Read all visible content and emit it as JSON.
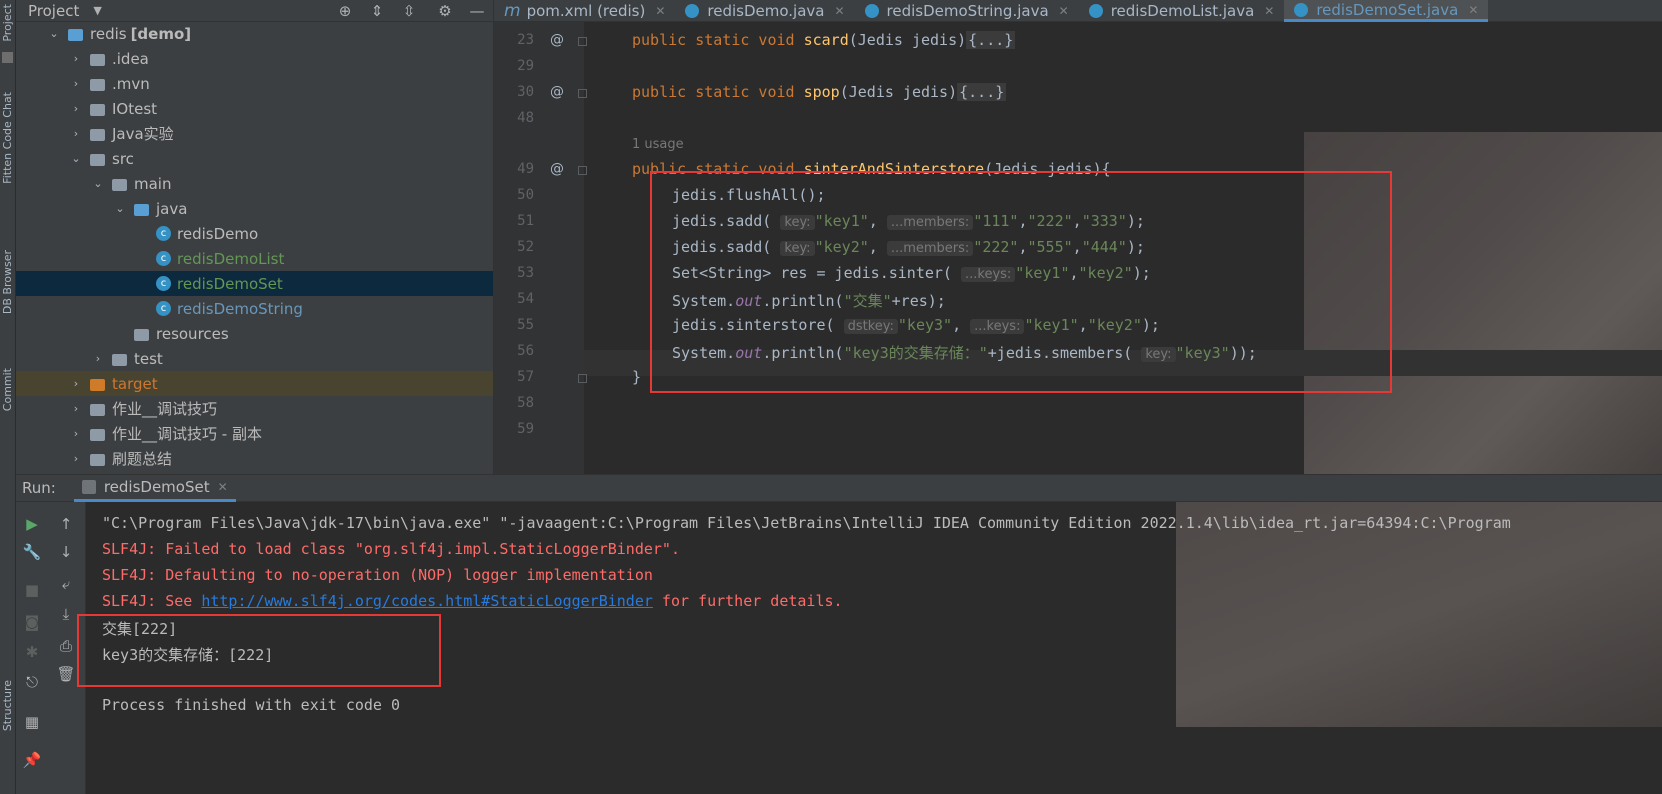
{
  "left_strip": {
    "labels": [
      "Project",
      "Fitten Code Chat",
      "DB Browser",
      "Commit",
      "Structure"
    ]
  },
  "project": {
    "title": "Project",
    "tree": [
      {
        "label": "redis",
        "suffix": "[demo]",
        "type": "folder-blue",
        "expanded": true
      },
      {
        "label": ".idea",
        "type": "folder",
        "expanded": false
      },
      {
        "label": ".mvn",
        "type": "folder",
        "expanded": false
      },
      {
        "label": "IOtest",
        "type": "folder",
        "expanded": false
      },
      {
        "label": "Java实验",
        "type": "folder",
        "expanded": false
      },
      {
        "label": "src",
        "type": "folder",
        "expanded": true
      },
      {
        "label": "main",
        "type": "folder",
        "expanded": true
      },
      {
        "label": "java",
        "type": "folder-blue",
        "expanded": true
      },
      {
        "label": "redisDemo",
        "type": "class",
        "color": "default"
      },
      {
        "label": "redisDemoList",
        "type": "class",
        "color": "green"
      },
      {
        "label": "redisDemoSet",
        "type": "class",
        "color": "green",
        "selected": true
      },
      {
        "label": "redisDemoString",
        "type": "class",
        "color": "blue"
      },
      {
        "label": "resources",
        "type": "folder-res"
      },
      {
        "label": "test",
        "type": "folder",
        "expanded": false
      },
      {
        "label": "target",
        "type": "folder-orange",
        "expanded": false,
        "excluded": true
      },
      {
        "label": "作业__调试技巧",
        "type": "folder",
        "expanded": false
      },
      {
        "label": "作业__调试技巧 - 副本",
        "type": "folder",
        "expanded": false
      },
      {
        "label": "刷题总结",
        "type": "folder",
        "expanded": false
      }
    ]
  },
  "tabs": [
    {
      "label": "pom.xml (redis)",
      "icon": "m",
      "active": false
    },
    {
      "label": "redisDemo.java",
      "icon": "class",
      "active": false
    },
    {
      "label": "redisDemoString.java",
      "icon": "class",
      "active": false
    },
    {
      "label": "redisDemoList.java",
      "icon": "class",
      "active": false
    },
    {
      "label": "redisDemoSet.java",
      "icon": "class",
      "active": true
    }
  ],
  "editor": {
    "line_numbers": [
      "23",
      "29",
      "30",
      "48",
      "49",
      "50",
      "51",
      "52",
      "53",
      "54",
      "55",
      "56",
      "57",
      "58",
      "59"
    ],
    "usage_hint": "1 usage",
    "hints": {
      "key": "key:",
      "members": "...members:",
      "keys": "...keys:",
      "dstkey": "dstkey:"
    },
    "lines": {
      "l23": {
        "kw": "public static void ",
        "fn": "scard",
        "rest": "(Jedis jedis)",
        "fold": "{...}"
      },
      "l30": {
        "kw": "public static void ",
        "fn": "spop",
        "rest": "(Jedis jedis)",
        "fold": "{...}"
      },
      "l49": {
        "kw": "public static void ",
        "fn": "sinterAndSinterstore",
        "rest": "(Jedis jedis){"
      },
      "l50": "jedis.flushAll();",
      "l51": {
        "pre": "jedis.sadd( ",
        "s1": "\"key1\"",
        "s2": "\"111\"",
        "s3": "\"222\"",
        "s4": "\"333\"",
        "end": ");"
      },
      "l52": {
        "pre": "jedis.sadd( ",
        "s1": "\"key2\"",
        "s2": "\"222\"",
        "s3": "\"555\"",
        "s4": "\"444\"",
        "end": ");"
      },
      "l53": {
        "pre": "Set<String> res = jedis.sinter( ",
        "s1": "\"key1\"",
        "s2": "\"key2\"",
        "end": ");"
      },
      "l54": {
        "pre": "System.",
        "out": "out",
        "mid": ".println(",
        "s1": "\"交集\"",
        "end": "+res);"
      },
      "l55": {
        "pre": "jedis.sinterstore( ",
        "s1": "\"key3\"",
        "s2": "\"key1\"",
        "s3": "\"key2\"",
        "end": ");"
      },
      "l56": {
        "pre": "System.",
        "out": "out",
        "mid": ".println(",
        "s1": "\"key3的交集存储：\"",
        "mid2": "+jedis.smembers( ",
        "s2": "\"key3\"",
        "end": "));"
      },
      "l57": "}"
    }
  },
  "run": {
    "label": "Run:",
    "tab": "redisDemoSet",
    "console": {
      "cmd": "\"C:\\Program Files\\Java\\jdk-17\\bin\\java.exe\" \"-javaagent:C:\\Program Files\\JetBrains\\IntelliJ IDEA Community Edition 2022.1.4\\lib\\idea_rt.jar=64394:C:\\Program",
      "err1": "SLF4J: Failed to load class \"org.slf4j.impl.StaticLoggerBinder\".",
      "err2": "SLF4J: Defaulting to no-operation (NOP) logger implementation",
      "err3_pre": "SLF4J: See ",
      "err3_link": "http://www.slf4j.org/codes.html#StaticLoggerBinder",
      "err3_post": " for further details.",
      "out1": "交集[222]",
      "out2": "key3的交集存储：[222]",
      "exit": "Process finished with exit code 0"
    }
  },
  "colors": {
    "keyword": "#cc7832",
    "function": "#ffc66d",
    "string": "#6a8759",
    "error": "#ff6b68",
    "link": "#287bde",
    "highlight_box": "#e53935"
  }
}
